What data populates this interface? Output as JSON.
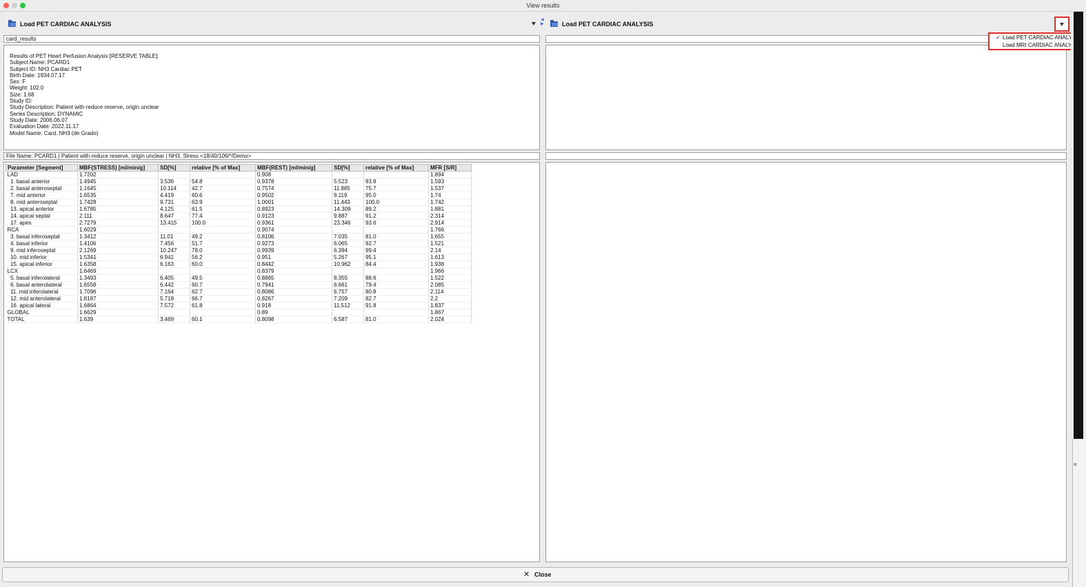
{
  "window": {
    "title": "View results"
  },
  "left_pane": {
    "load_label": "Load PET CARDIAC ANALYSIS",
    "name_field": "card_results",
    "info_text": "Results of PET Heart Perfusion Analysis [RESERVE TABLE]:\nSubject Name: PCARD1\nSubject ID: NH3 Cardiac PET\nBirth Date: 1934.07.17\nSex: F\nWeight: 102.0\nSize: 1.68\nStudy ID:\nStudy Description: Patient with reduce reserve, origin unclear\nSeries Description: DYNAMIC\nStudy Date: 2006.06.07\nEvaluation Date: 2022.11.17\nModel Name: Card. NH3 (de Grado)",
    "file_name": "File Name: PCARD1 | Patient with reduce reserve, origin unclear | NH3, Stress <18/40/106/*/Demo>",
    "table": {
      "headers": [
        "Parameter [Segment]",
        "MBF(STRESS) [ml/min/g]",
        "SD[%]",
        "relative [% of Max]",
        "MBF(REST) [ml/min/g]",
        "SD[%]",
        "relative [% of Max]",
        "MFR [S/R]"
      ],
      "rows": [
        [
          "LAD",
          "1.7202",
          "",
          "",
          "0.908",
          "",
          "",
          "1.894"
        ],
        [
          "  1. basal anterior",
          "1.4945",
          "3.536",
          "54.8",
          "0.9378",
          "5.523",
          "93.8",
          "1.593"
        ],
        [
          "  2. basal anteroseptal",
          "1.1645",
          "10.114",
          "42.7",
          "0.7574",
          "11.885",
          "75.7",
          "1.537"
        ],
        [
          "  7. mid anterior",
          "1.6535",
          "4.419",
          "60.6",
          "0.9502",
          "9.119",
          "95.0",
          "1.74"
        ],
        [
          "  8. mid anteroseptal",
          "1.7428",
          "9.731",
          "63.9",
          "1.0001",
          "11.443",
          "100.0",
          "1.742"
        ],
        [
          "  13. apical anterior",
          "1.6785",
          "4.125",
          "61.5",
          "0.8923",
          "14.309",
          "89.2",
          "1.881"
        ],
        [
          "  14. apical septal",
          "2.111",
          "8.647",
          "77.4",
          "0.9123",
          "9.887",
          "91.2",
          "2.314"
        ],
        [
          "  17. apex",
          "2.7279",
          "13.415",
          "100.0",
          "0.9361",
          "23.346",
          "93.6",
          "2.914"
        ],
        [
          "RCA",
          "1.6029",
          "",
          "",
          "0.9074",
          "",
          "",
          "1.766"
        ],
        [
          "  3. basal inferoseptal",
          "1.3412",
          "11.01",
          "49.2",
          "0.8106",
          "7.035",
          "81.0",
          "1.655"
        ],
        [
          "  4. basal inferior",
          "1.4106",
          "7.456",
          "51.7",
          "0.9273",
          "6.065",
          "92.7",
          "1.521"
        ],
        [
          "  9. mid inferoseptal",
          "2.1269",
          "10.247",
          "78.0",
          "0.9939",
          "6.394",
          "99.4",
          "2.14"
        ],
        [
          "  10. mid inferior",
          "1.5341",
          "6.941",
          "56.2",
          "0.951",
          "5.267",
          "95.1",
          "1.613"
        ],
        [
          "  15. apical inferior",
          "1.6358",
          "6.163",
          "60.0",
          "0.8442",
          "10.962",
          "84.4",
          "1.938"
        ],
        [
          "LCX",
          "1.6469",
          "",
          "",
          "0.8379",
          "",
          "",
          "1.966"
        ],
        [
          "  5. basal inferolateral",
          "1.3493",
          "6.405",
          "49.5",
          "0.8865",
          "8.355",
          "88.6",
          "1.522"
        ],
        [
          "  6. basal anterolateral",
          "1.6558",
          "6.442",
          "60.7",
          "0.7941",
          "6.661",
          "79.4",
          "2.085"
        ],
        [
          "  11. mid inferolateral",
          "1.7096",
          "7.164",
          "62.7",
          "0.8086",
          "6.757",
          "80.8",
          "2.114"
        ],
        [
          "  12. mid anterolateral",
          "1.8187",
          "5.718",
          "66.7",
          "0.8267",
          "7.209",
          "82.7",
          "2.2"
        ],
        [
          "  16. apical lateral",
          "1.6864",
          "7.572",
          "61.8",
          "0.918",
          "11.512",
          "91.8",
          "1.837"
        ],
        [
          "GLOBAL",
          "1.6629",
          "",
          "",
          "0.89",
          "",
          "",
          "1.867"
        ],
        [
          "TOTAL",
          "1.639",
          "3.469",
          "60.1",
          "0.8098",
          "6.587",
          "81.0",
          "2.024"
        ]
      ]
    }
  },
  "right_pane": {
    "load_label": "Load PET CARDIAC ANALYSIS",
    "dropdown_options": [
      {
        "label": "Load PET CARDIAC ANALYSIS",
        "checked": "✓"
      },
      {
        "label": "Load MRI CARDIAC ANALYSIS",
        "checked": ""
      }
    ]
  },
  "footer": {
    "close_label": "Close",
    "close_icon": "close-icon"
  },
  "colors": {
    "highlight": "#e0302a",
    "folder": "#2f5aa8"
  }
}
